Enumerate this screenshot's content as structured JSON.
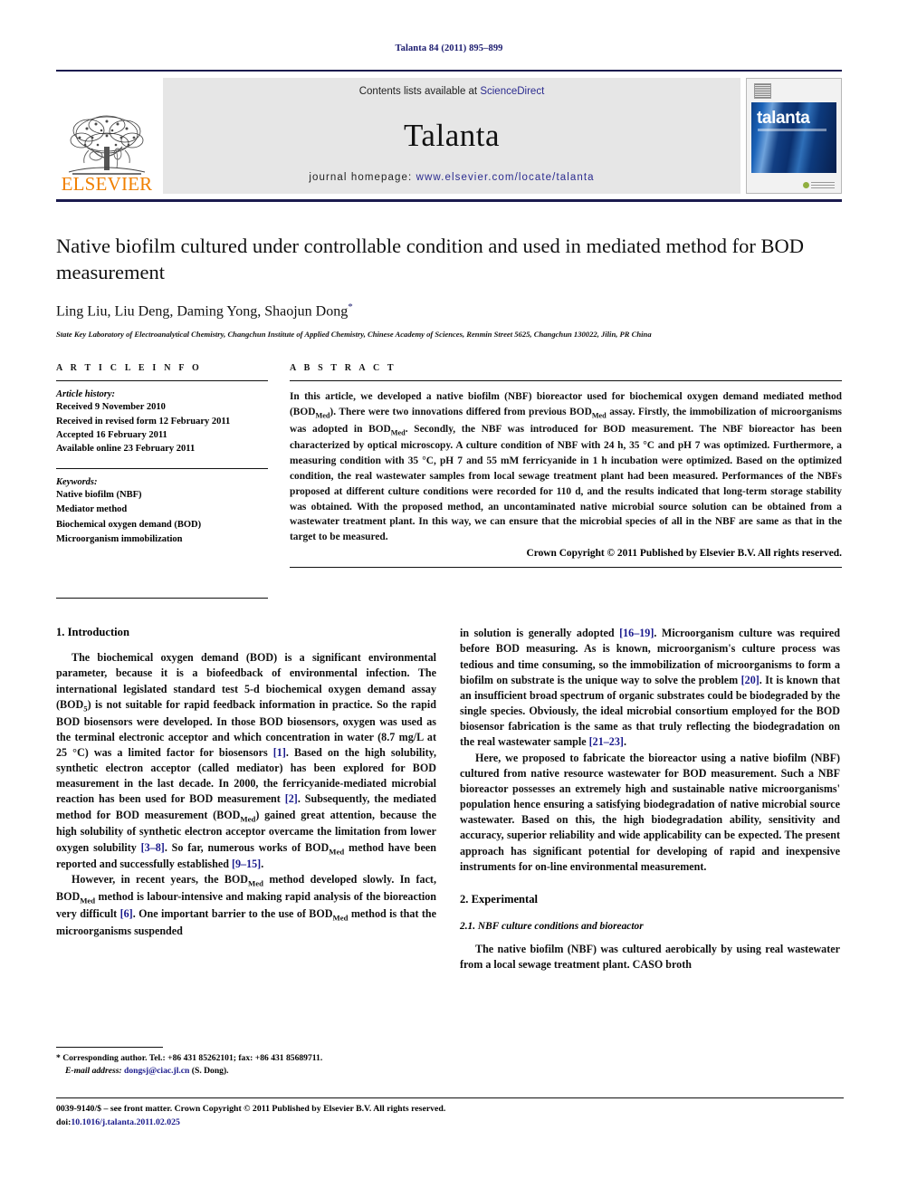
{
  "running_head": "Talanta 84 (2011) 895–899",
  "masthead": {
    "publisher_name": "ELSEVIER",
    "contents_prefix": "Contents lists available at ",
    "contents_link": "ScienceDirect",
    "journal_name": "Talanta",
    "homepage_prefix": "journal homepage: ",
    "homepage_url": "www.elsevier.com/locate/talanta",
    "cover_title": "talanta",
    "accent_orange": "#f08000",
    "accent_blue": "#2b2b8f",
    "banner_bg": "#e6e6e6"
  },
  "article": {
    "title": "Native biofilm cultured under controllable condition and used in mediated method for BOD measurement",
    "authors": "Ling Liu, Liu Deng, Daming Yong, Shaojun Dong",
    "author_star": "*",
    "affiliation": "State Key Laboratory of Electroanalytical Chemistry, Changchun Institute of Applied Chemistry, Chinese Academy of Sciences, Renmin Street 5625, Changchun 130022, Jilin, PR China"
  },
  "article_info": {
    "heading": "A R T I C L E   I N F O",
    "history_label": "Article history:",
    "history": [
      "Received 9 November 2010",
      "Received in revised form 12 February 2011",
      "Accepted 16 February 2011",
      "Available online 23 February 2011"
    ],
    "keywords_label": "Keywords:",
    "keywords": [
      "Native biofilm (NBF)",
      "Mediator method",
      "Biochemical oxygen demand (BOD)",
      "Microorganism immobilization"
    ]
  },
  "abstract": {
    "heading": "A B S T R A C T",
    "paragraphs": [
      "In this article, we developed a native biofilm (NBF) bioreactor used for biochemical oxygen demand mediated method (BOD<sub>Med</sub>). There were two innovations differed from previous BOD<sub>Med</sub> assay. Firstly, the immobilization of microorganisms was adopted in BOD<sub>Med</sub>. Secondly, the NBF was introduced for BOD measurement. The NBF bioreactor has been characterized by optical microscopy. A culture condition of NBF with 24 h, 35 °C and pH 7 was optimized. Furthermore, a measuring condition with 35 °C, pH 7 and 55 mM ferricyanide in 1 h incubation were optimized. Based on the optimized condition, the real wastewater samples from local sewage treatment plant had been measured. Performances of the NBFs proposed at different culture conditions were recorded for 110 d, and the results indicated that long-term storage stability was obtained. With the proposed method, an uncontaminated native microbial source solution can be obtained from a wastewater treatment plant. In this way, we can ensure that the microbial species of all in the NBF are same as that in the target to be measured."
    ],
    "copyright": "Crown Copyright © 2011 Published by Elsevier B.V. All rights reserved."
  },
  "sections": {
    "introduction": {
      "heading": "1.  Introduction",
      "paragraphs": [
        "The biochemical oxygen demand (BOD) is a significant environmental parameter, because it is a biofeedback of environmental infection. The international legislated standard test 5-d biochemical oxygen demand assay (BOD<sub>5</sub>) is not suitable for rapid feedback information in practice. So the rapid BOD biosensors were developed. In those BOD biosensors, oxygen was used as the terminal electronic acceptor and which concentration in water (8.7 mg/L at 25 °C) was a limited factor for biosensors <span class=\"cite\">[1]</span>. Based on the high solubility, synthetic electron acceptor (called mediator) has been explored for BOD measurement in the last decade. In 2000, the ferricyanide-mediated microbial reaction has been used for BOD measurement <span class=\"cite\">[2]</span>. Subsequently, the mediated method for BOD measurement (BOD<sub>Med</sub>) gained great attention, because the high solubility of synthetic electron acceptor overcame the limitation from lower oxygen solubility <span class=\"cite\">[3–8]</span>. So far, numerous works of BOD<sub>Med</sub> method have been reported and successfully established <span class=\"cite\">[9–15]</span>.",
        "However, in recent years, the BOD<sub>Med</sub> method developed slowly. In fact, BOD<sub>Med</sub> method is labour-intensive and making rapid analysis of the bioreaction very difficult <span class=\"cite\">[6]</span>. One important barrier to the use of BOD<sub>Med</sub> method is that the microorganisms suspended",
        "in solution is generally adopted <span class=\"cite\">[16–19]</span>. Microorganism culture was required before BOD measuring. As is known, microorganism's culture process was tedious and time consuming, so the immobilization of microorganisms to form a biofilm on substrate is the unique way to solve the problem <span class=\"cite\">[20]</span>. It is known that an insufficient broad spectrum of organic substrates could be biodegraded by the single species. Obviously, the ideal microbial consortium employed for the BOD biosensor fabrication is the same as that truly reflecting the biodegradation on the real wastewater sample <span class=\"cite\">[21–23]</span>.",
        "Here, we proposed to fabricate the bioreactor using a native biofilm (NBF) cultured from native resource wastewater for BOD measurement. Such a NBF bioreactor possesses an extremely high and sustainable native microorganisms' population hence ensuring a satisfying biodegradation of native microbial source wastewater. Based on this, the high biodegradation ability, sensitivity and accuracy, superior reliability and wide applicability can be expected. The present approach has significant potential for developing of rapid and inexpensive instruments for on-line environmental measurement."
      ]
    },
    "experimental": {
      "heading": "2.  Experimental",
      "subsection_heading": "2.1.  NBF culture conditions and bioreactor",
      "paragraphs": [
        "The native biofilm (NBF) was cultured aerobically by using real wastewater from a local sewage treatment plant. CASO broth"
      ]
    }
  },
  "footnote": {
    "star": "*",
    "corresponding": " Corresponding author. Tel.: +86 431 85262101; fax: +86 431 85689711.",
    "email_label": "E-mail address: ",
    "email": "dongsj@ciac.jl.cn",
    "email_suffix": " (S. Dong)."
  },
  "page_footer": {
    "front_matter": "0039-9140/$ – see front matter. Crown Copyright © 2011 Published by Elsevier B.V. All rights reserved.",
    "doi_label": "doi:",
    "doi": "10.1016/j.talanta.2011.02.025"
  }
}
